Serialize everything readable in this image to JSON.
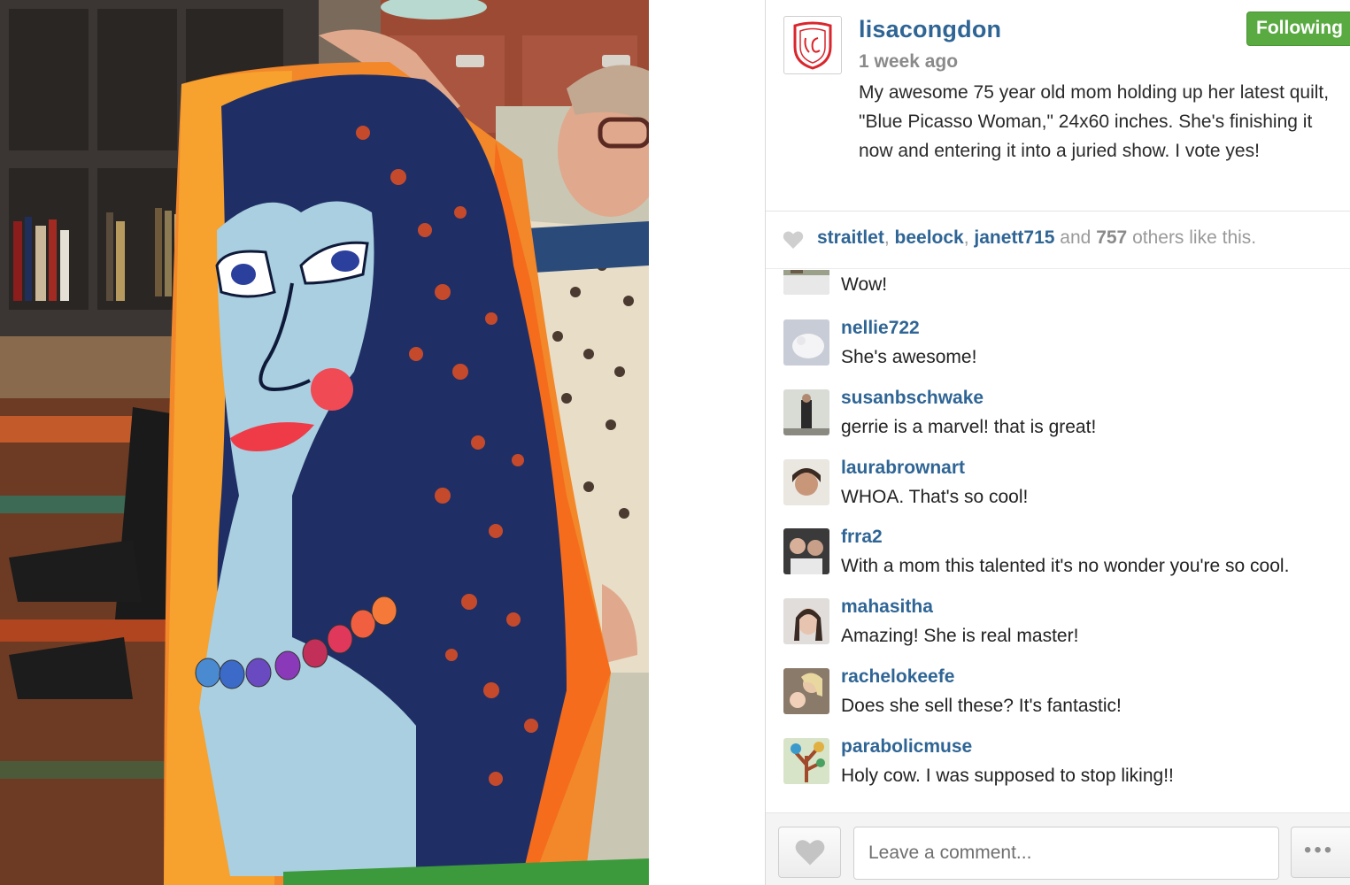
{
  "post": {
    "username": "lisacongdon",
    "time_ago": "1 week ago",
    "caption": "My awesome 75 year old mom holding up her latest quilt, \"Blue Picasso Woman,\" 24x60 inches. She's finishing it now and entering it into a juried show. I vote yes!",
    "follow_label": "Following",
    "follow_color": "#5aaa42"
  },
  "likes": {
    "users": [
      "straitlet",
      "beelock",
      "janett715"
    ],
    "sep1": ", ",
    "sep2": ", ",
    "and_word": " and ",
    "count": "757",
    "suffix": " others like this."
  },
  "comments": [
    {
      "user": "",
      "text": "Wow!"
    },
    {
      "user": "nellie722",
      "text": "She's awesome!"
    },
    {
      "user": "susanbschwake",
      "text": "gerrie is a marvel! that is great!"
    },
    {
      "user": "laurabrownart",
      "text": "WHOA. That's so cool!"
    },
    {
      "user": "frra2",
      "text": "With a mom this talented it's no wonder you're so cool."
    },
    {
      "user": "mahasitha",
      "text": "Amazing! She is real master!"
    },
    {
      "user": "rachelokeefe",
      "text": "Does she sell these? It's fantastic!"
    },
    {
      "user": "parabolicmuse",
      "text": "Holy cow. I was supposed to stop liking!!"
    }
  ],
  "footer": {
    "comment_placeholder": "Leave a comment...",
    "more_label": "•••"
  },
  "colors": {
    "link": "#2f6595",
    "muted": "#8a8a8a"
  }
}
